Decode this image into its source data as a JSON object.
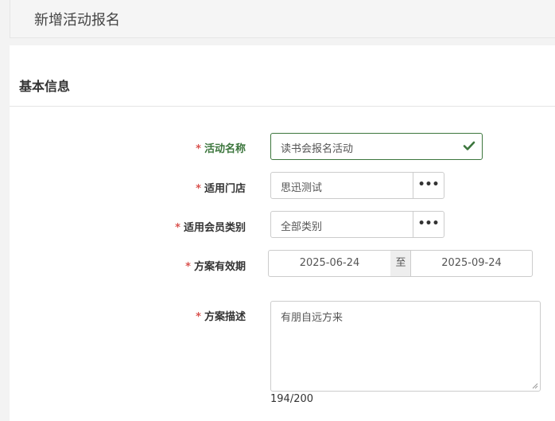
{
  "header": {
    "title": "新增活动报名"
  },
  "section": {
    "title": "基本信息"
  },
  "form": {
    "activity_name": {
      "required": "*",
      "label": "活动名称",
      "value": "读书会报名活动"
    },
    "store": {
      "required": "*",
      "label": "适用门店",
      "value": "思迅测试",
      "button": "•••"
    },
    "member_type": {
      "required": "*",
      "label": "适用会员类别",
      "value": "全部类别",
      "button": "•••"
    },
    "validity": {
      "required": "*",
      "label": "方案有效期",
      "start": "2025-06-24",
      "separator": "至",
      "end": "2025-09-24"
    },
    "description": {
      "required": "*",
      "label": "方案描述",
      "value": "有朋自远方来",
      "counter": "194/200"
    }
  },
  "colors": {
    "success": "#3c763d",
    "required": "#d9534f"
  }
}
